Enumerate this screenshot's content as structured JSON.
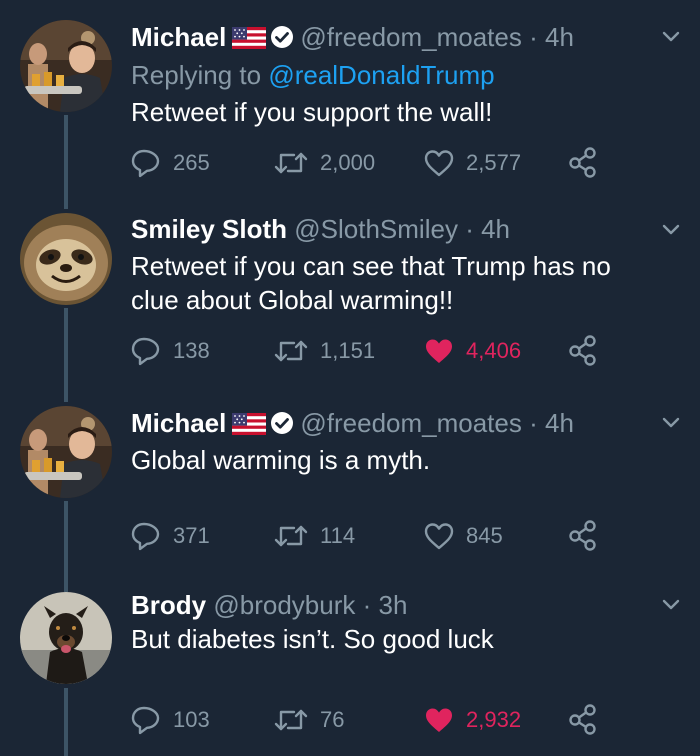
{
  "tweets": [
    {
      "name": "Michael",
      "handle": "@freedom_moates",
      "time": "4h",
      "replying_prefix": "Replying to",
      "replying_to": "@realDonaldTrump",
      "text": "Retweet if you support the wall!",
      "replies": "265",
      "retweets": "2,000",
      "likes": "2,577",
      "liked": false
    },
    {
      "name": "Smiley Sloth",
      "handle": "@SlothSmiley",
      "time": "4h",
      "text_line1": "Retweet if you can see that Trump has no",
      "text_line2": "clue about Global warming!!",
      "replies": "138",
      "retweets": "1,151",
      "likes": "4,406",
      "liked": true
    },
    {
      "name": "Michael",
      "handle": "@freedom_moates",
      "time": "4h",
      "text": "Global warming is a myth.",
      "replies": "371",
      "retweets": "114",
      "likes": "845",
      "liked": false
    },
    {
      "name": "Brody",
      "handle": "@brodyburk",
      "time": "3h",
      "text": "But diabetes isn’t. So good luck",
      "replies": "103",
      "retweets": "76",
      "likes": "2,932",
      "liked": true
    }
  ],
  "separator": "·",
  "colors": {
    "background": "#1b2635",
    "secondary_text": "#8899a6",
    "link": "#1da1f2",
    "liked": "#e0245e",
    "thread_line": "#3d5466"
  },
  "icons": [
    "reply-icon",
    "retweet-icon",
    "like-icon",
    "share-icon",
    "chevron-down-icon",
    "verified-badge-icon",
    "us-flag-icon"
  ]
}
